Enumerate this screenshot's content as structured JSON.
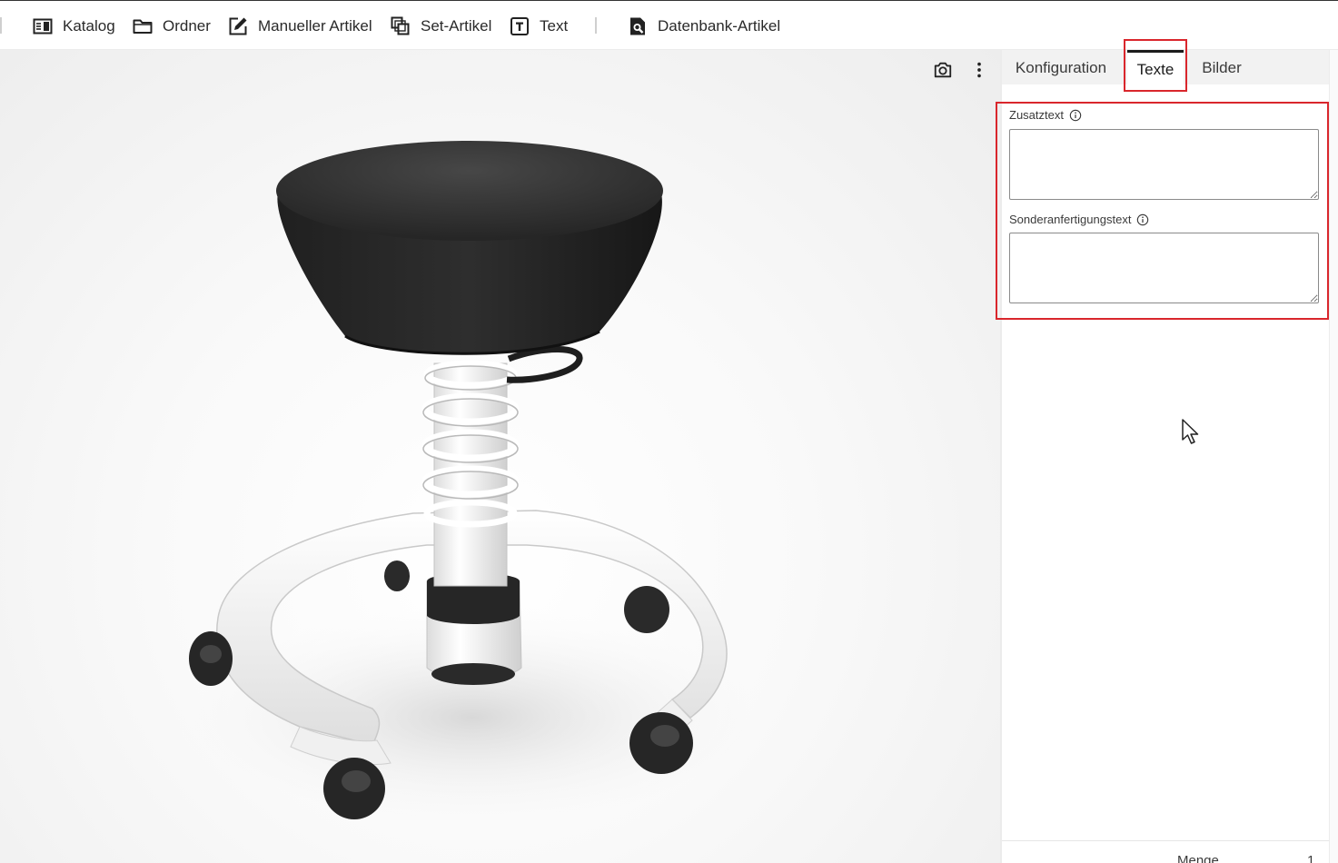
{
  "toolbar": {
    "items": [
      {
        "label": "Katalog",
        "icon": "catalog-book-icon"
      },
      {
        "label": "Ordner",
        "icon": "folder-icon"
      },
      {
        "label": "Manueller Artikel",
        "icon": "edit-icon"
      },
      {
        "label": "Set-Artikel",
        "icon": "copy-stack-icon"
      },
      {
        "label": "Text",
        "icon": "text-box-icon"
      },
      {
        "label": "Datenbank-Artikel",
        "icon": "database-search-icon"
      }
    ]
  },
  "viewer": {
    "actions": [
      {
        "icon": "camera-icon"
      },
      {
        "icon": "more-vertical-icon"
      }
    ]
  },
  "panel": {
    "tabs": [
      {
        "label": "Konfiguration",
        "active": false
      },
      {
        "label": "Texte",
        "active": true
      },
      {
        "label": "Bilder",
        "active": false
      }
    ],
    "fields": [
      {
        "label": "Zusatztext",
        "value": ""
      },
      {
        "label": "Sonderanfertigungstext",
        "value": ""
      }
    ],
    "footer": {
      "label": "Menge",
      "value": "1"
    }
  },
  "colors": {
    "highlight": "#d9262c",
    "seat": "#1f1f1f",
    "frame": "#f4f4f4"
  }
}
